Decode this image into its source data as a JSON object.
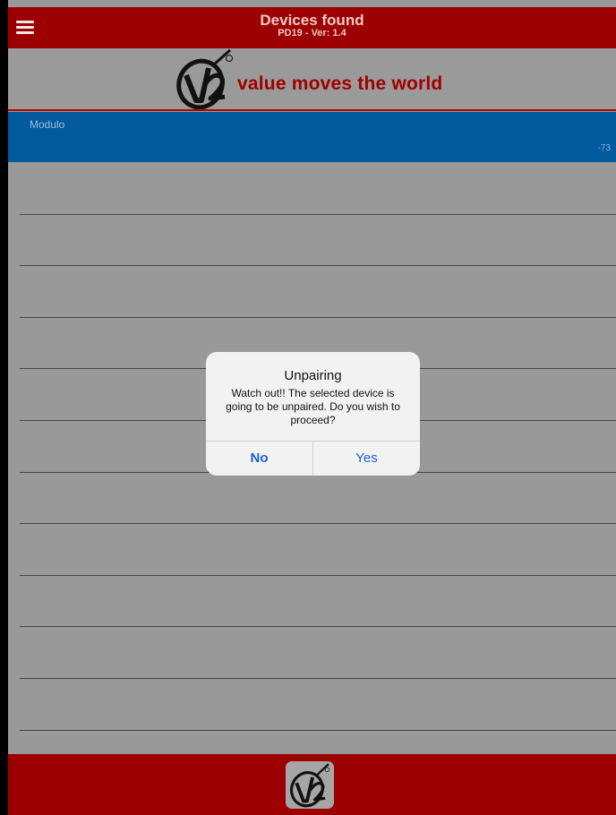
{
  "header": {
    "title": "Devices found",
    "subtitle": "PD19 - Ver: 1.4",
    "menu_icon": "hamburger-menu-icon"
  },
  "brand": {
    "logo_icon": "v2-logo-icon",
    "tagline": "value moves the world",
    "accent_color": "#a00000"
  },
  "devices": [
    {
      "name": "Modulo",
      "rssi": "-73",
      "selected": true
    }
  ],
  "footer": {
    "logo_icon": "v2-logo-icon"
  },
  "alert": {
    "title": "Unpairing",
    "message": "Watch out!! The selected device is going to be unpaired. Do you wish to proceed?",
    "buttons": {
      "no": "No",
      "yes": "Yes"
    }
  },
  "colors": {
    "header_red": "#9d0000",
    "selected_blue": "#005a9c",
    "background_gray": "#999999",
    "alert_button_blue": "#1a5fd0"
  }
}
